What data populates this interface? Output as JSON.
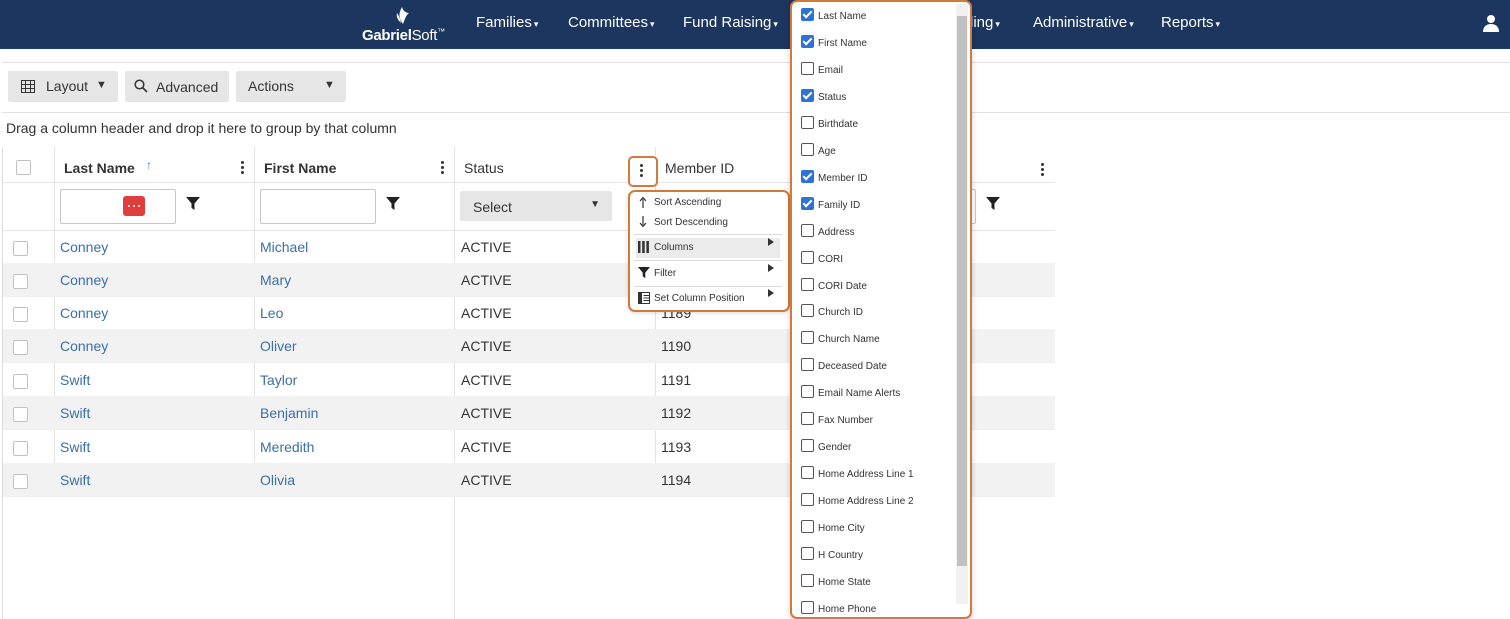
{
  "brand": {
    "part1": "Gabriel",
    "part2": "Soft",
    "tm": "™"
  },
  "nav": {
    "items": [
      {
        "label": "Families"
      },
      {
        "label": "Committees"
      },
      {
        "label": "Fund Raising"
      },
      {
        "label": "ling"
      },
      {
        "label": "Administrative"
      },
      {
        "label": "Reports"
      }
    ],
    "caret": "▾"
  },
  "toolbar": {
    "layout": "Layout",
    "advanced": "Advanced",
    "actions": "Actions",
    "caret": "▼"
  },
  "group_hint": "Drag a column header and drop it here to group by that column",
  "grid": {
    "headers": {
      "last_name": "Last Name",
      "sort_arrow": "↑",
      "first_name": "First Name",
      "status": "Status",
      "member_id": "Member ID"
    },
    "status_select": "Select",
    "rows": [
      {
        "last": "Conney",
        "first": "Michael",
        "status": "ACTIVE",
        "member_id": ""
      },
      {
        "last": "Conney",
        "first": "Mary",
        "status": "ACTIVE",
        "member_id": ""
      },
      {
        "last": "Conney",
        "first": "Leo",
        "status": "ACTIVE",
        "member_id": "1189"
      },
      {
        "last": "Conney",
        "first": "Oliver",
        "status": "ACTIVE",
        "member_id": "1190"
      },
      {
        "last": "Swift",
        "first": "Taylor",
        "status": "ACTIVE",
        "member_id": "1191"
      },
      {
        "last": "Swift",
        "first": "Benjamin",
        "status": "ACTIVE",
        "member_id": "1192"
      },
      {
        "last": "Swift",
        "first": "Meredith",
        "status": "ACTIVE",
        "member_id": "1193"
      },
      {
        "last": "Swift",
        "first": "Olivia",
        "status": "ACTIVE",
        "member_id": "1194"
      }
    ]
  },
  "column_menu": {
    "sort_asc": "Sort Ascending",
    "sort_desc": "Sort Descending",
    "columns": "Columns",
    "filter": "Filter",
    "set_position": "Set Column Position"
  },
  "columns_panel": [
    {
      "label": "Last Name",
      "checked": true
    },
    {
      "label": "First Name",
      "checked": true
    },
    {
      "label": "Email",
      "checked": false
    },
    {
      "label": "Status",
      "checked": true
    },
    {
      "label": "Birthdate",
      "checked": false
    },
    {
      "label": "Age",
      "checked": false
    },
    {
      "label": "Member ID",
      "checked": true
    },
    {
      "label": "Family ID",
      "checked": true
    },
    {
      "label": "Address",
      "checked": false
    },
    {
      "label": "CORI",
      "checked": false
    },
    {
      "label": "CORI Date",
      "checked": false
    },
    {
      "label": "Church ID",
      "checked": false
    },
    {
      "label": "Church Name",
      "checked": false
    },
    {
      "label": "Deceased Date",
      "checked": false
    },
    {
      "label": "Email Name Alerts",
      "checked": false
    },
    {
      "label": "Fax Number",
      "checked": false
    },
    {
      "label": "Gender",
      "checked": false
    },
    {
      "label": "Home Address Line 1",
      "checked": false
    },
    {
      "label": "Home Address Line 2",
      "checked": false
    },
    {
      "label": "Home City",
      "checked": false
    },
    {
      "label": "H Country",
      "checked": false
    },
    {
      "label": "Home State",
      "checked": false
    },
    {
      "label": "Home Phone",
      "checked": false
    }
  ]
}
